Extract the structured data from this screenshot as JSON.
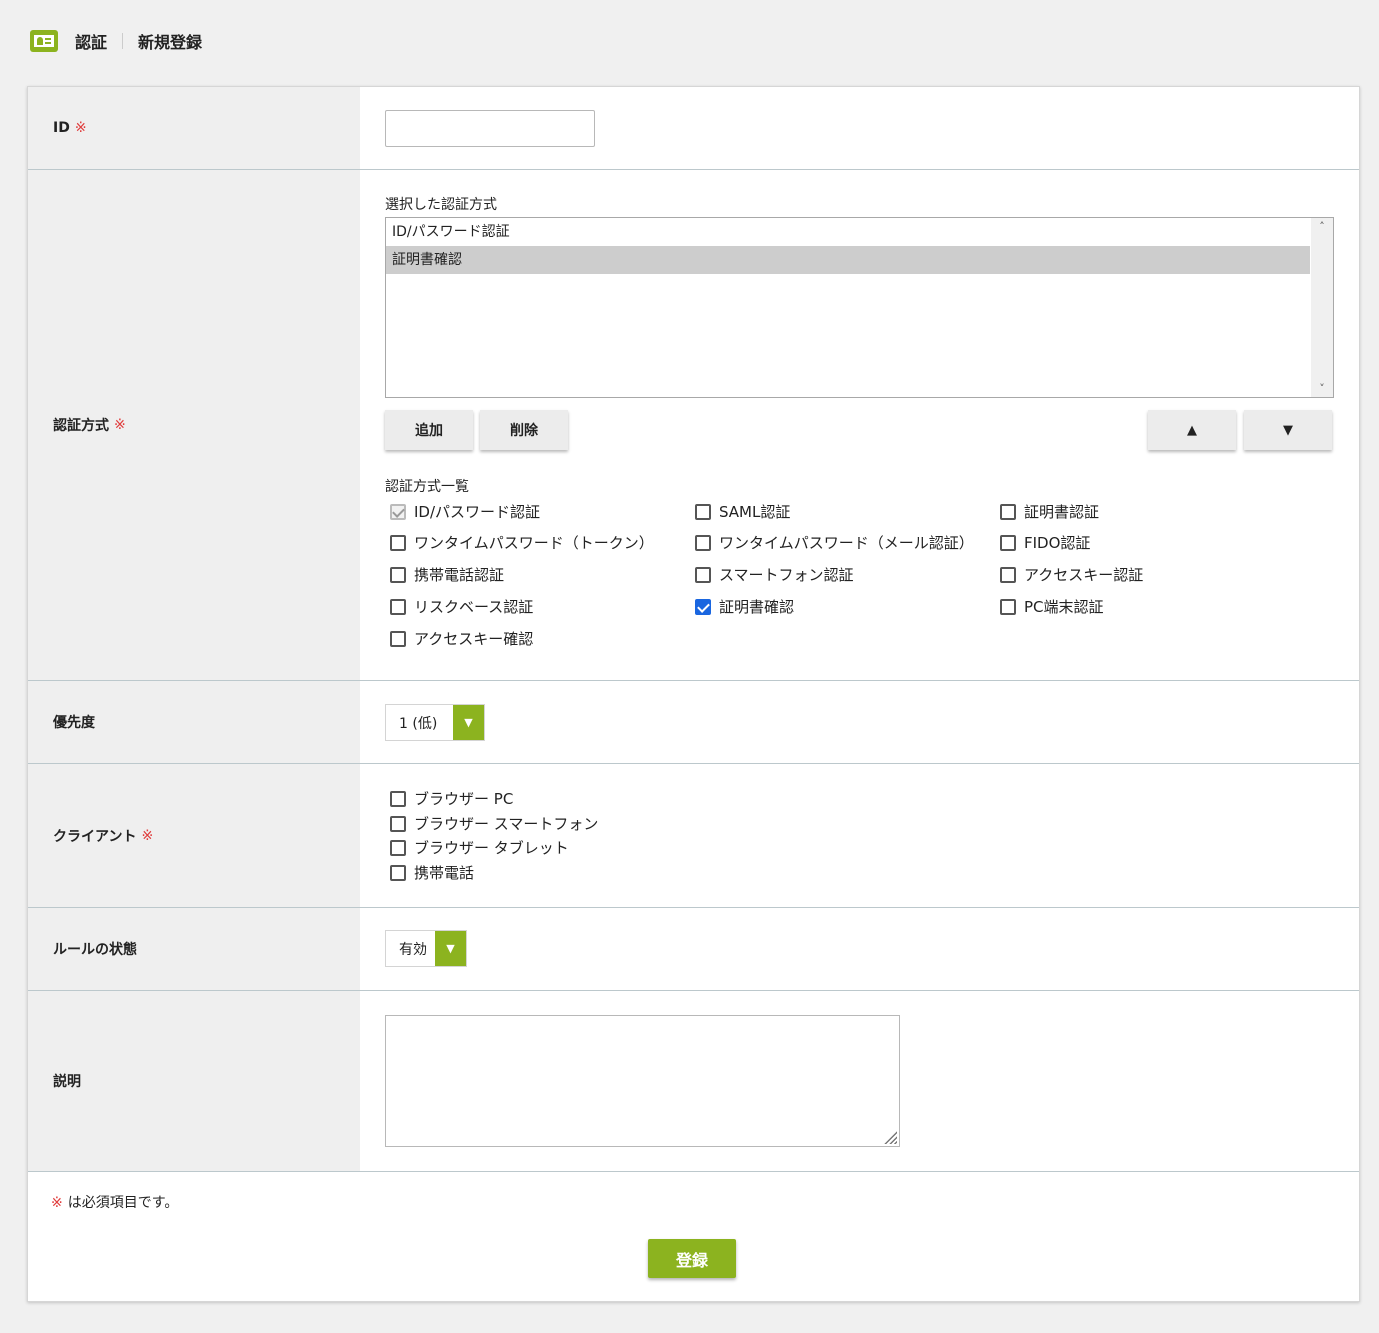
{
  "header": {
    "icon": "id-card-icon",
    "title": "認証",
    "subtitle": "新規登録"
  },
  "required_mark": "※",
  "form": {
    "id": {
      "label": "ID",
      "value": ""
    },
    "auth_method": {
      "label": "認証方式",
      "selected_title": "選択した認証方式",
      "selected_options": [
        "ID/パスワード認証",
        "証明書確認"
      ],
      "add_label": "追加",
      "delete_label": "削除",
      "up_label": "▲",
      "down_label": "▼",
      "list_title": "認証方式一覧",
      "methods": [
        {
          "label": "ID/パスワード認証",
          "state": "disabled-checked"
        },
        {
          "label": "SAML認証",
          "state": "unchecked"
        },
        {
          "label": "証明書認証",
          "state": "unchecked"
        },
        {
          "label": "ワンタイムパスワード（トークン）",
          "state": "unchecked"
        },
        {
          "label": "ワンタイムパスワード（メール認証）",
          "state": "unchecked"
        },
        {
          "label": "FIDO認証",
          "state": "unchecked"
        },
        {
          "label": "携帯電話認証",
          "state": "unchecked"
        },
        {
          "label": "スマートフォン認証",
          "state": "unchecked"
        },
        {
          "label": "アクセスキー認証",
          "state": "unchecked"
        },
        {
          "label": "リスクベース認証",
          "state": "unchecked"
        },
        {
          "label": "証明書確認",
          "state": "checked"
        },
        {
          "label": "PC端末認証",
          "state": "unchecked"
        },
        {
          "label": "アクセスキー確認",
          "state": "unchecked"
        }
      ]
    },
    "priority": {
      "label": "優先度",
      "value": "1 (低)"
    },
    "client": {
      "label": "クライアント",
      "options": [
        {
          "label": "ブラウザー PC",
          "checked": false
        },
        {
          "label": "ブラウザー スマートフォン",
          "checked": false
        },
        {
          "label": "ブラウザー タブレット",
          "checked": false
        },
        {
          "label": "携帯電話",
          "checked": false
        }
      ]
    },
    "status": {
      "label": "ルールの状態",
      "value": "有効"
    },
    "description": {
      "label": "説明",
      "value": ""
    }
  },
  "footer": {
    "note": "は必須項目です。",
    "submit_label": "登録"
  },
  "colors": {
    "accent": "#8cb31f",
    "required": "#e03c3c",
    "checkbox_checked": "#1a66e0"
  }
}
